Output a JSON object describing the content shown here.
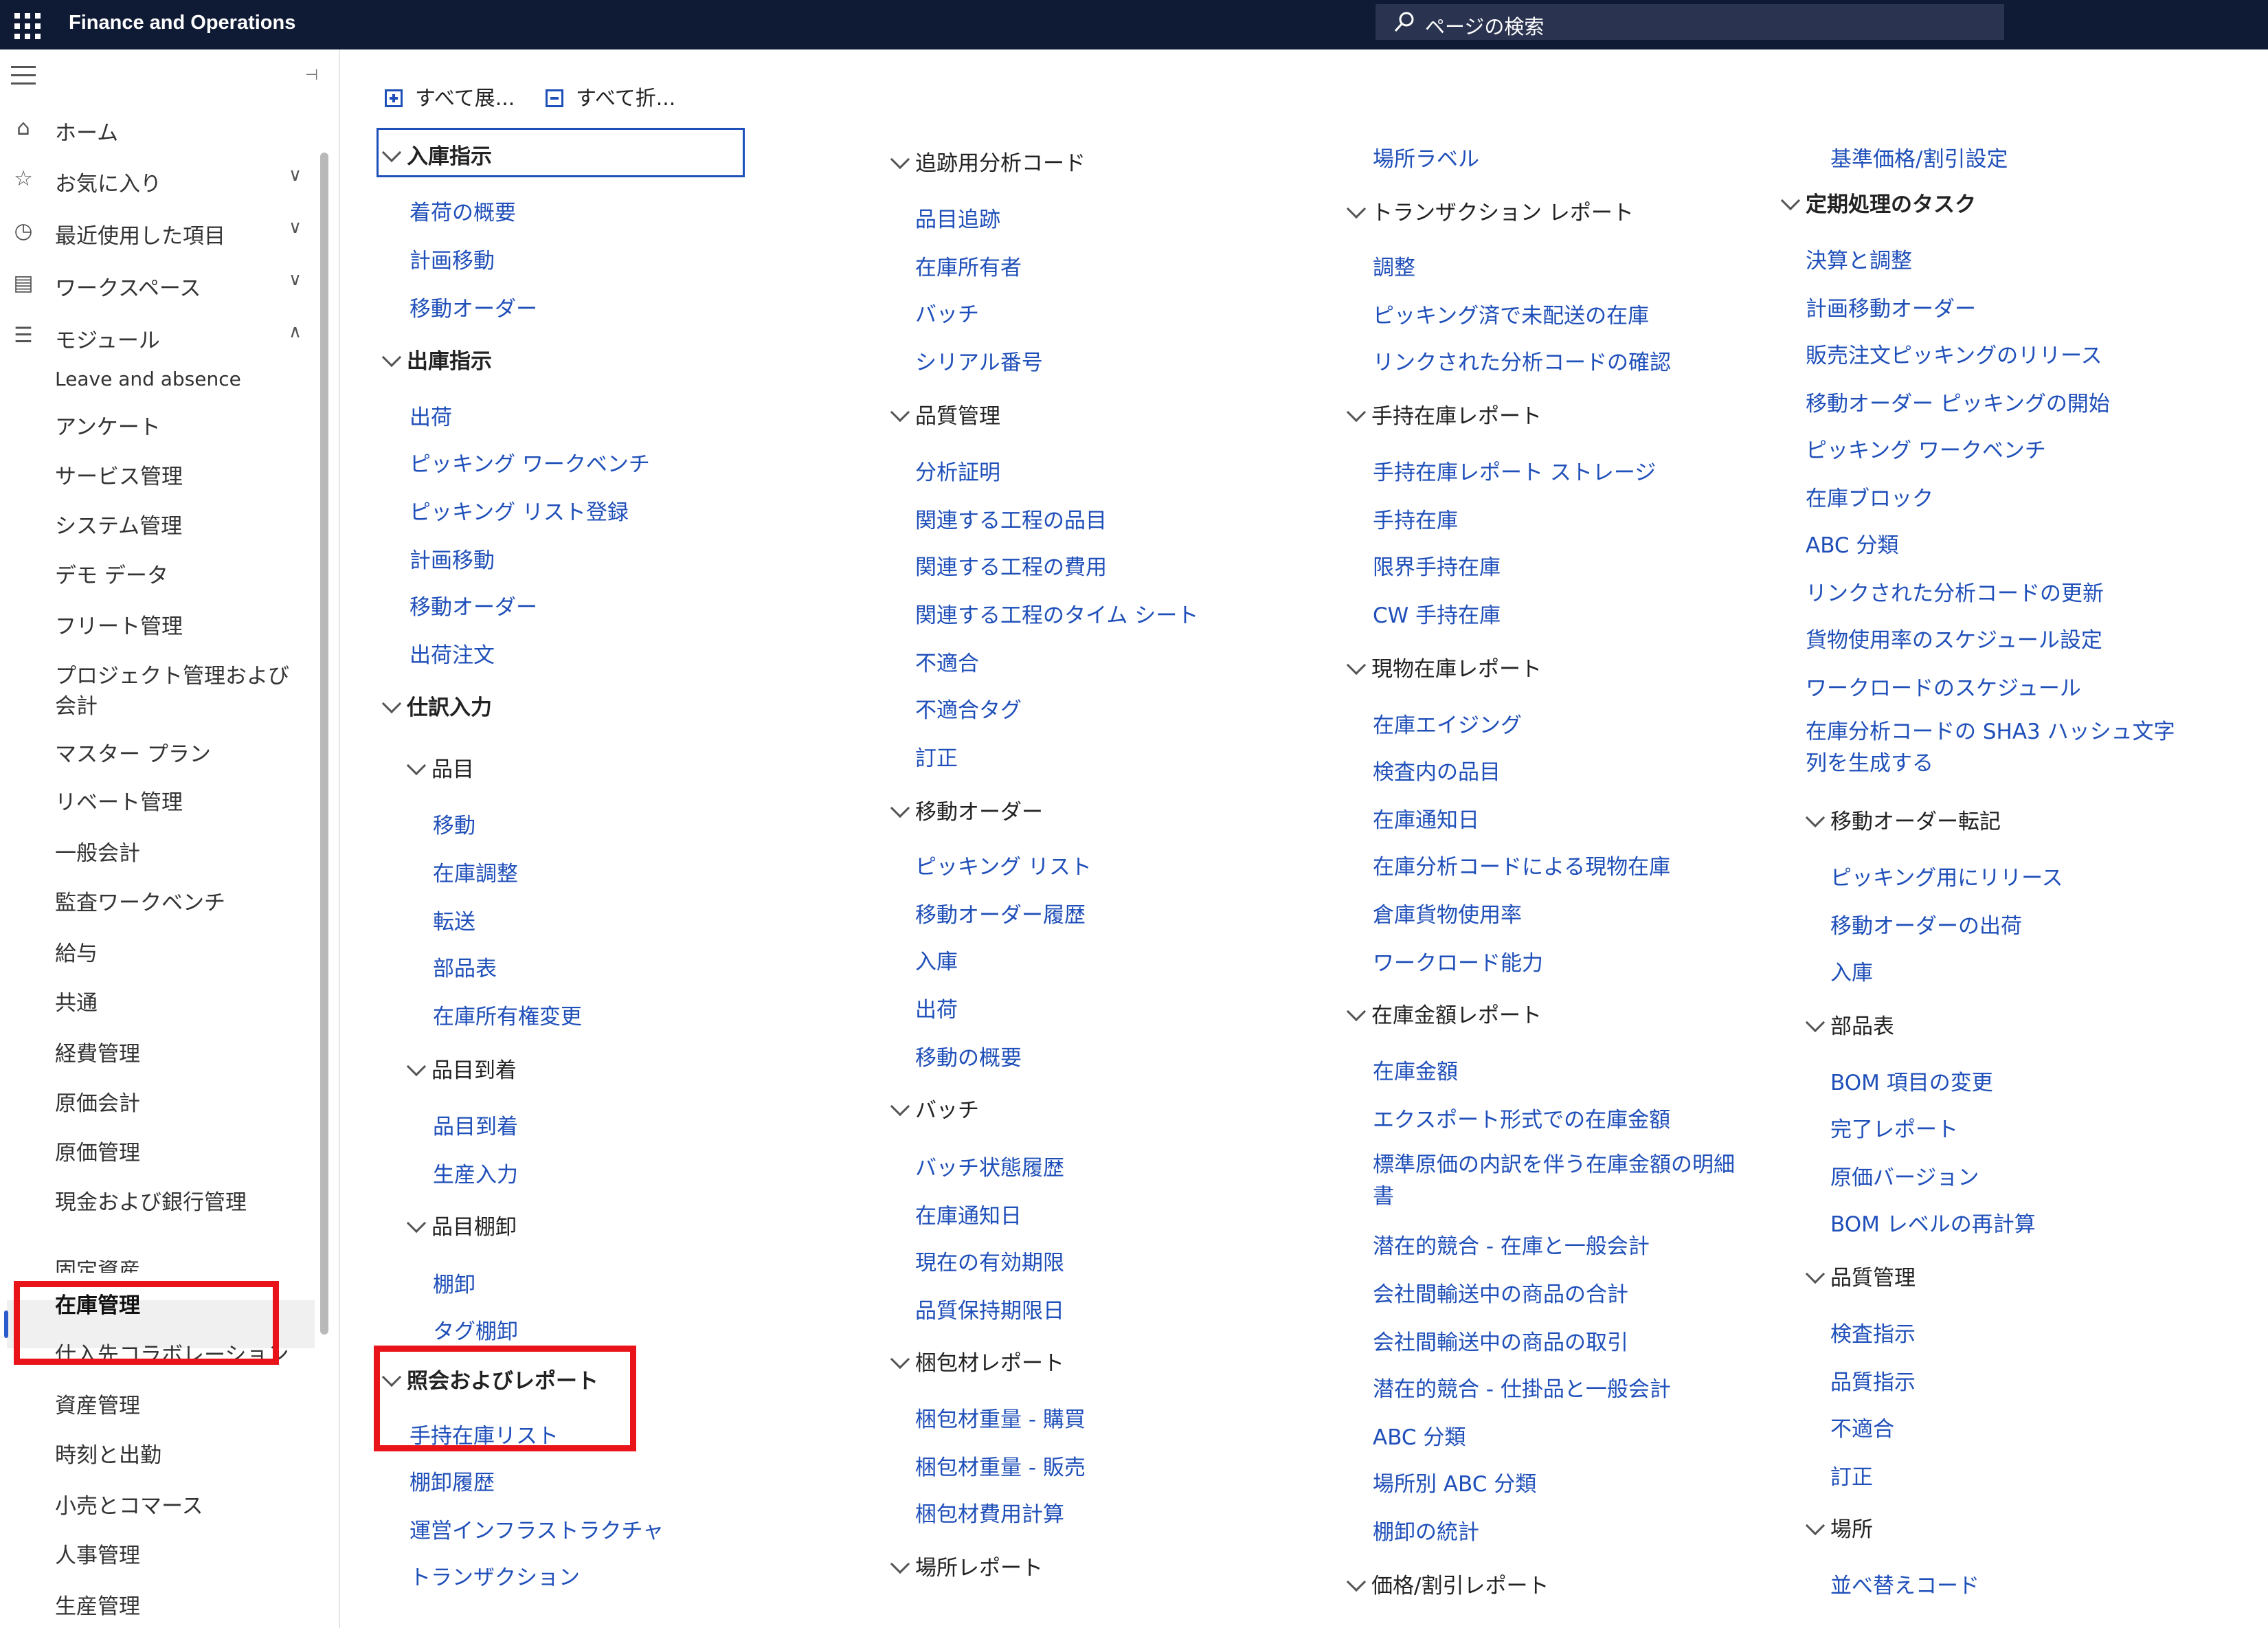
{
  "app": {
    "title": "Finance and Operations",
    "search_placeholder": "ページの検索"
  },
  "nav": {
    "home": "ホーム",
    "favorites": "お気に入り",
    "recent": "最近使用した項目",
    "workspaces": "ワークスペース",
    "modules": "モジュール",
    "module_items": [
      "Leave and absence",
      "アンケート",
      "サービス管理",
      "システム管理",
      "デモ データ",
      "フリート管理",
      "プロジェクト管理および会計",
      "マスター プラン",
      "リベート管理",
      "一般会計",
      "監査ワークベンチ",
      "給与",
      "共通",
      "経費管理",
      "原価会計",
      "原価管理",
      "現金および銀行管理",
      "固定資産",
      "在庫管理",
      "仕入先コラボレーション",
      "資産管理",
      "時刻と出勤",
      "小売とコマース",
      "人事管理",
      "生産管理"
    ]
  },
  "toolbar": {
    "expand_all": "すべて展...",
    "collapse_all": "すべて折..."
  },
  "col1": {
    "s1": "入庫指示",
    "s1_links": [
      "着荷の概要",
      "計画移動",
      "移動オーダー"
    ],
    "s2": "出庫指示",
    "s2_links": [
      "出荷",
      "ピッキング ワークベンチ",
      "ピッキング リスト登録",
      "計画移動",
      "移動オーダー",
      "出荷注文"
    ],
    "s3": "仕訳入力",
    "s3a": "品目",
    "s3a_links": [
      "移動",
      "在庫調整",
      "転送",
      "部品表",
      "在庫所有権変更"
    ],
    "s3b": "品目到着",
    "s3b_links": [
      "品目到着",
      "生産入力"
    ],
    "s3c": "品目棚卸",
    "s3c_links": [
      "棚卸",
      "タグ棚卸"
    ],
    "s4": "照会およびレポート",
    "s4_links": [
      "手持在庫リスト",
      "棚卸履歴",
      "運営インフラストラクチャ",
      "トランザクション"
    ]
  },
  "col2": {
    "s1": "追跡用分析コード",
    "s1_links": [
      "品目追跡",
      "在庫所有者",
      "バッチ",
      "シリアル番号"
    ],
    "s2": "品質管理",
    "s2_links": [
      "分析証明",
      "関連する工程の品目",
      "関連する工程の費用",
      "関連する工程のタイム シート",
      "不適合",
      "不適合タグ",
      "訂正"
    ],
    "s3": "移動オーダー",
    "s3_links": [
      "ピッキング リスト",
      "移動オーダー履歴",
      "入庫",
      "出荷",
      "移動の概要"
    ],
    "s4": "バッチ",
    "s4_links": [
      "バッチ状態履歴",
      "在庫通知日",
      "現在の有効期限",
      "品質保持期限日"
    ],
    "s5": "梱包材レポート",
    "s5_links": [
      "梱包材重量 - 購買",
      "梱包材重量 - 販売",
      "梱包材費用計算"
    ],
    "s6": "場所レポート"
  },
  "col3": {
    "top_link": "場所ラベル",
    "s1": "トランザクション レポート",
    "s1_links": [
      "調整",
      "ピッキング済で未配送の在庫",
      "リンクされた分析コードの確認"
    ],
    "s2": "手持在庫レポート",
    "s2_links": [
      "手持在庫レポート ストレージ",
      "手持在庫",
      "限界手持在庫",
      "CW 手持在庫"
    ],
    "s3": "現物在庫レポート",
    "s3_links": [
      "在庫エイジング",
      "検査内の品目",
      "在庫通知日",
      "在庫分析コードによる現物在庫",
      "倉庫貨物使用率",
      "ワークロード能力"
    ],
    "s4": "在庫金額レポート",
    "s4_links": [
      "在庫金額",
      "エクスポート形式での在庫金額",
      "標準原価の内訳を伴う在庫金額の明細書",
      "潜在的競合 - 在庫と一般会計",
      "会社間輸送中の商品の合計",
      "会社間輸送中の商品の取引",
      "潜在的競合 - 仕掛品と一般会計",
      "ABC 分類",
      "場所別 ABC 分類",
      "棚卸の統計"
    ],
    "s5": "価格/割引レポート"
  },
  "col4": {
    "top_link": "基準価格/割引設定",
    "s1": "定期処理のタスク",
    "s1_links": [
      "決算と調整",
      "計画移動オーダー",
      "販売注文ピッキングのリリース",
      "移動オーダー ピッキングの開始",
      "ピッキング ワークベンチ",
      "在庫ブロック",
      "ABC 分類",
      "リンクされた分析コードの更新",
      "貨物使用率のスケジュール設定",
      "ワークロードのスケジュール",
      "在庫分析コードの SHA3 ハッシュ文字列を生成する"
    ],
    "s2": "移動オーダー転記",
    "s2_links": [
      "ピッキング用にリリース",
      "移動オーダーの出荷",
      "入庫"
    ],
    "s3": "部品表",
    "s3_links": [
      "BOM 項目の変更",
      "完了レポート",
      "原価バージョン",
      "BOM レベルの再計算"
    ],
    "s4": "品質管理",
    "s4_links": [
      "検査指示",
      "品質指示",
      "不適合",
      "訂正"
    ],
    "s5": "場所",
    "s5_links": [
      "並べ替えコード"
    ]
  }
}
